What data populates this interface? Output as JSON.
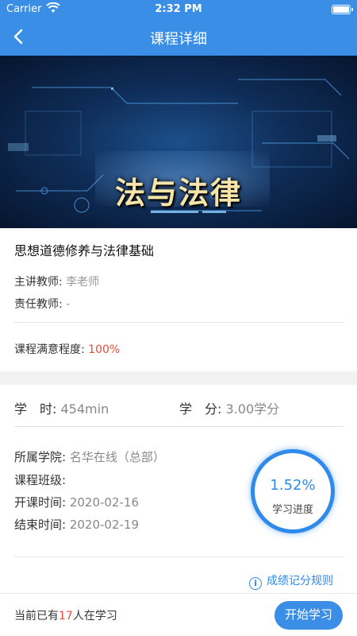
{
  "status_bar": {
    "carrier": "Carrier",
    "time": "2:32 PM"
  },
  "nav": {
    "title": "课程详细"
  },
  "banner": {
    "text": "法与法律"
  },
  "course": {
    "name": "思想道德修养与法律基础",
    "lecturer_label": "主讲教师:",
    "lecturer": "李老师",
    "responsible_label": "责任教师:",
    "responsible": "-",
    "satisfaction_label": "课程满意程度:",
    "satisfaction": "100%"
  },
  "stats": {
    "hours_label": "学　时:",
    "hours": "454min",
    "credits_label": "学　分:",
    "credits": "3.00学分"
  },
  "details": {
    "college_label": "所属学院:",
    "college": "名华在线（总部）",
    "class_label": "课程班级:",
    "class": "",
    "start_label": "开课时间:",
    "start": "2020-02-16",
    "end_label": "结束时间:",
    "end": "2020-02-19"
  },
  "progress": {
    "value": "1.52%",
    "label": "学习进度"
  },
  "rules_link": "成绩记分规则",
  "bottom": {
    "prefix": "当前已有",
    "count": "17",
    "suffix": "人在学习",
    "start_button": "开始学习"
  },
  "colors": {
    "primary": "#3a8ee6",
    "accent_red": "#e84c3d"
  }
}
